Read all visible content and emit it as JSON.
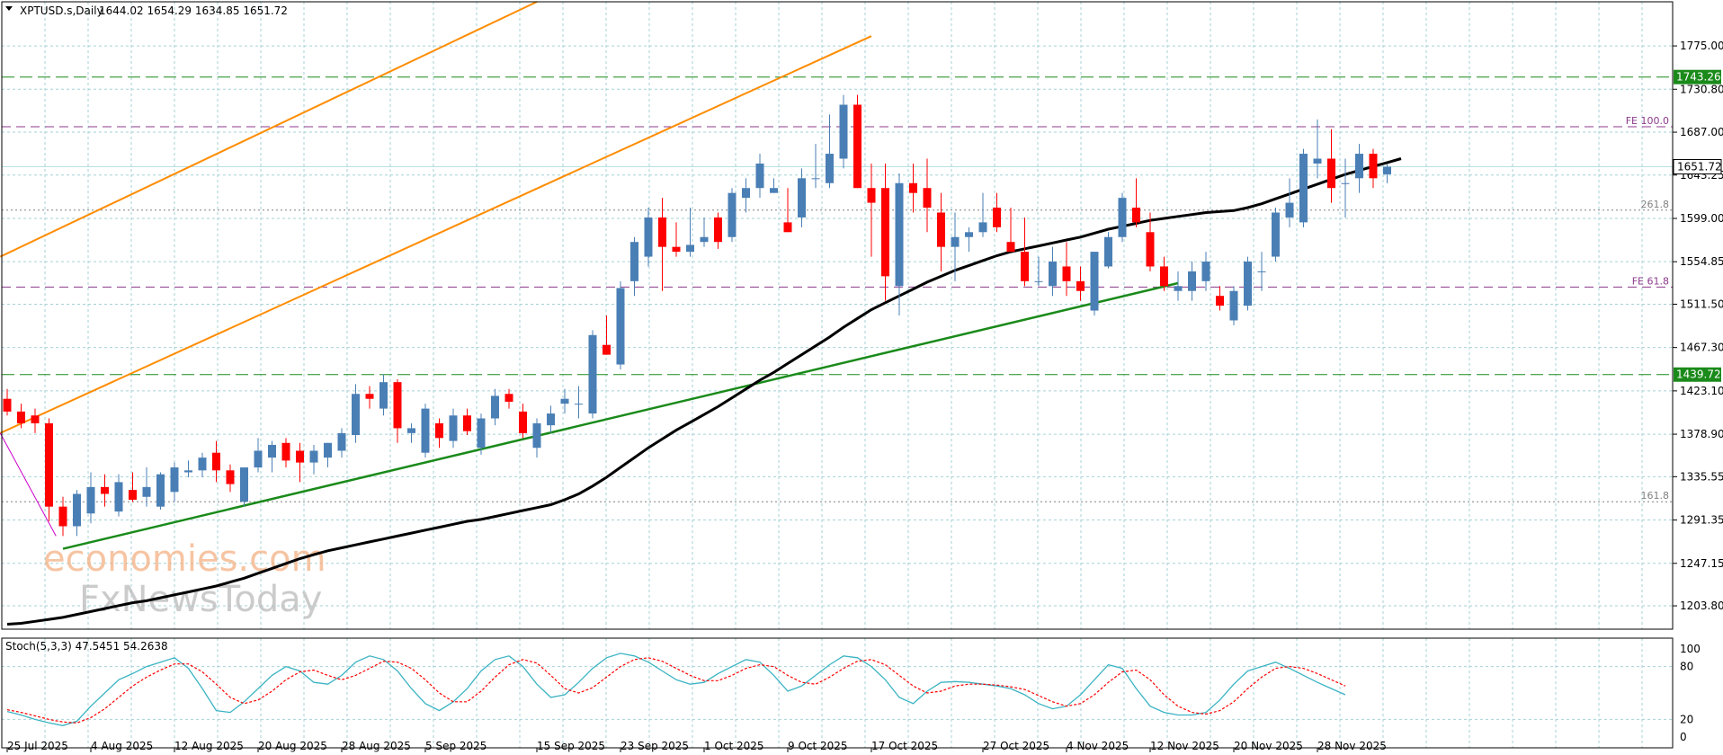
{
  "header": {
    "symbol": "XPTUSD.s,Daily",
    "ohlc": "1644.02 1654.29 1634.85 1651.72"
  },
  "watermark": {
    "line1": "economies.com",
    "line2": "FxNewsToday"
  },
  "oscillator": {
    "label": "Stoch(5,3,3) 47.5451 54.2638",
    "scale": [
      "100",
      "80",
      "20",
      "0"
    ]
  },
  "colors": {
    "bull": "#4a7fb5",
    "bear": "#ff0000",
    "grid": "#a6d2d6",
    "ma": "#000000",
    "channel": "#ff8c00",
    "trendline": "#1a8a1a",
    "support_resistance": "#1a8a1a",
    "fib": "#8b3a8b",
    "stoch_main": "#3bb3c3",
    "stoch_signal": "#ff0000"
  },
  "chart_data": {
    "type": "candlestick",
    "symbol": "XPTUSD.s",
    "timeframe": "Daily",
    "y_ticks": [
      "1775.00",
      "1730.80",
      "1687.00",
      "1643.25",
      "1599.00",
      "1554.85",
      "1511.50",
      "1467.30",
      "1423.10",
      "1378.90",
      "1335.55",
      "1291.35",
      "1247.15",
      "1203.80"
    ],
    "y_range": [
      1180,
      1820
    ],
    "x_ticks": [
      "25 Jul 2025",
      "4 Aug 2025",
      "12 Aug 2025",
      "20 Aug 2025",
      "28 Aug 2025",
      "5 Sep 2025",
      "15 Sep 2025",
      "23 Sep 2025",
      "1 Oct 2025",
      "9 Oct 2025",
      "17 Oct 2025",
      "27 Oct 2025",
      "4 Nov 2025",
      "12 Nov 2025",
      "20 Nov 2025",
      "28 Nov 2025"
    ],
    "x_tick_index": [
      0,
      6,
      12,
      18,
      24,
      30,
      38,
      44,
      50,
      56,
      62,
      70,
      76,
      82,
      88,
      94
    ],
    "current_price": "1651.72",
    "levels": [
      {
        "name": "resistance",
        "value": 1743.26,
        "label": "1743.26",
        "style": "dashed-green"
      },
      {
        "name": "support",
        "value": 1439.72,
        "label": "1439.72",
        "style": "dashed-green"
      },
      {
        "name": "fe-100",
        "value": 1692.5,
        "label": "FE 100.0",
        "style": "dashed-purple"
      },
      {
        "name": "fe-61.8",
        "value": 1529.0,
        "label": "FE 61.8",
        "style": "dashed-purple"
      },
      {
        "name": "fib-261.8",
        "value": 1607.5,
        "label": "261.8",
        "style": "dotted-gray"
      },
      {
        "name": "fib-161.8",
        "value": 1310.0,
        "label": "161.8",
        "style": "dotted-gray"
      }
    ],
    "candles": [
      {
        "o": 1415,
        "h": 1425,
        "l": 1398,
        "c": 1402
      },
      {
        "o": 1402,
        "h": 1410,
        "l": 1385,
        "c": 1390
      },
      {
        "o": 1398,
        "h": 1405,
        "l": 1380,
        "c": 1390
      },
      {
        "o": 1390,
        "h": 1395,
        "l": 1290,
        "c": 1305
      },
      {
        "o": 1305,
        "h": 1315,
        "l": 1275,
        "c": 1285
      },
      {
        "o": 1285,
        "h": 1322,
        "l": 1275,
        "c": 1318
      },
      {
        "o": 1298,
        "h": 1340,
        "l": 1288,
        "c": 1325
      },
      {
        "o": 1325,
        "h": 1338,
        "l": 1305,
        "c": 1318
      },
      {
        "o": 1300,
        "h": 1338,
        "l": 1295,
        "c": 1330
      },
      {
        "o": 1322,
        "h": 1340,
        "l": 1310,
        "c": 1312
      },
      {
        "o": 1315,
        "h": 1345,
        "l": 1305,
        "c": 1325
      },
      {
        "o": 1305,
        "h": 1340,
        "l": 1302,
        "c": 1338
      },
      {
        "o": 1320,
        "h": 1350,
        "l": 1310,
        "c": 1345
      },
      {
        "o": 1340,
        "h": 1352,
        "l": 1335,
        "c": 1342
      },
      {
        "o": 1342,
        "h": 1360,
        "l": 1335,
        "c": 1355
      },
      {
        "o": 1360,
        "h": 1372,
        "l": 1330,
        "c": 1342
      },
      {
        "o": 1342,
        "h": 1348,
        "l": 1320,
        "c": 1328
      },
      {
        "o": 1310,
        "h": 1345,
        "l": 1305,
        "c": 1345
      },
      {
        "o": 1345,
        "h": 1375,
        "l": 1340,
        "c": 1362
      },
      {
        "o": 1355,
        "h": 1372,
        "l": 1340,
        "c": 1368
      },
      {
        "o": 1370,
        "h": 1375,
        "l": 1345,
        "c": 1352
      },
      {
        "o": 1362,
        "h": 1370,
        "l": 1330,
        "c": 1350
      },
      {
        "o": 1350,
        "h": 1368,
        "l": 1338,
        "c": 1362
      },
      {
        "o": 1355,
        "h": 1370,
        "l": 1345,
        "c": 1370
      },
      {
        "o": 1362,
        "h": 1385,
        "l": 1355,
        "c": 1380
      },
      {
        "o": 1378,
        "h": 1430,
        "l": 1370,
        "c": 1420
      },
      {
        "o": 1420,
        "h": 1428,
        "l": 1405,
        "c": 1415
      },
      {
        "o": 1405,
        "h": 1440,
        "l": 1398,
        "c": 1432
      },
      {
        "o": 1432,
        "h": 1435,
        "l": 1370,
        "c": 1385
      },
      {
        "o": 1380,
        "h": 1390,
        "l": 1370,
        "c": 1385
      },
      {
        "o": 1360,
        "h": 1410,
        "l": 1355,
        "c": 1405
      },
      {
        "o": 1390,
        "h": 1395,
        "l": 1365,
        "c": 1375
      },
      {
        "o": 1372,
        "h": 1405,
        "l": 1365,
        "c": 1398
      },
      {
        "o": 1398,
        "h": 1405,
        "l": 1378,
        "c": 1382
      },
      {
        "o": 1365,
        "h": 1400,
        "l": 1358,
        "c": 1395
      },
      {
        "o": 1395,
        "h": 1425,
        "l": 1388,
        "c": 1418
      },
      {
        "o": 1420,
        "h": 1425,
        "l": 1405,
        "c": 1412
      },
      {
        "o": 1402,
        "h": 1410,
        "l": 1375,
        "c": 1380
      },
      {
        "o": 1365,
        "h": 1395,
        "l": 1355,
        "c": 1390
      },
      {
        "o": 1388,
        "h": 1408,
        "l": 1380,
        "c": 1400
      },
      {
        "o": 1410,
        "h": 1425,
        "l": 1400,
        "c": 1415
      },
      {
        "o": 1410,
        "h": 1428,
        "l": 1395,
        "c": 1410
      },
      {
        "o": 1400,
        "h": 1485,
        "l": 1395,
        "c": 1480
      },
      {
        "o": 1470,
        "h": 1500,
        "l": 1460,
        "c": 1460
      },
      {
        "o": 1450,
        "h": 1535,
        "l": 1445,
        "c": 1528
      },
      {
        "o": 1535,
        "h": 1580,
        "l": 1520,
        "c": 1575
      },
      {
        "o": 1560,
        "h": 1610,
        "l": 1550,
        "c": 1600
      },
      {
        "o": 1600,
        "h": 1620,
        "l": 1525,
        "c": 1570
      },
      {
        "o": 1570,
        "h": 1595,
        "l": 1560,
        "c": 1565
      },
      {
        "o": 1565,
        "h": 1610,
        "l": 1560,
        "c": 1572
      },
      {
        "o": 1575,
        "h": 1600,
        "l": 1570,
        "c": 1580
      },
      {
        "o": 1600,
        "h": 1605,
        "l": 1568,
        "c": 1575
      },
      {
        "o": 1580,
        "h": 1630,
        "l": 1575,
        "c": 1625
      },
      {
        "o": 1620,
        "h": 1640,
        "l": 1605,
        "c": 1630
      },
      {
        "o": 1630,
        "h": 1665,
        "l": 1620,
        "c": 1655
      },
      {
        "o": 1625,
        "h": 1640,
        "l": 1625,
        "c": 1630
      },
      {
        "o": 1595,
        "h": 1630,
        "l": 1590,
        "c": 1585
      },
      {
        "o": 1600,
        "h": 1650,
        "l": 1590,
        "c": 1640
      },
      {
        "o": 1640,
        "h": 1675,
        "l": 1630,
        "c": 1640
      },
      {
        "o": 1635,
        "h": 1705,
        "l": 1630,
        "c": 1665
      },
      {
        "o": 1660,
        "h": 1725,
        "l": 1650,
        "c": 1715
      },
      {
        "o": 1715,
        "h": 1725,
        "l": 1630,
        "c": 1630
      },
      {
        "o": 1630,
        "h": 1655,
        "l": 1560,
        "c": 1615
      },
      {
        "o": 1630,
        "h": 1655,
        "l": 1515,
        "c": 1540
      },
      {
        "o": 1530,
        "h": 1645,
        "l": 1500,
        "c": 1635
      },
      {
        "o": 1635,
        "h": 1655,
        "l": 1605,
        "c": 1625
      },
      {
        "o": 1630,
        "h": 1660,
        "l": 1585,
        "c": 1610
      },
      {
        "o": 1605,
        "h": 1625,
        "l": 1545,
        "c": 1570
      },
      {
        "o": 1570,
        "h": 1605,
        "l": 1535,
        "c": 1580
      },
      {
        "o": 1580,
        "h": 1590,
        "l": 1565,
        "c": 1585
      },
      {
        "o": 1585,
        "h": 1625,
        "l": 1580,
        "c": 1595
      },
      {
        "o": 1610,
        "h": 1625,
        "l": 1585,
        "c": 1590
      },
      {
        "o": 1575,
        "h": 1610,
        "l": 1565,
        "c": 1565
      },
      {
        "o": 1565,
        "h": 1600,
        "l": 1530,
        "c": 1535
      },
      {
        "o": 1535,
        "h": 1560,
        "l": 1530,
        "c": 1535
      },
      {
        "o": 1530,
        "h": 1570,
        "l": 1520,
        "c": 1555
      },
      {
        "o": 1550,
        "h": 1575,
        "l": 1520,
        "c": 1535
      },
      {
        "o": 1535,
        "h": 1550,
        "l": 1515,
        "c": 1525
      },
      {
        "o": 1505,
        "h": 1565,
        "l": 1500,
        "c": 1565
      },
      {
        "o": 1550,
        "h": 1585,
        "l": 1548,
        "c": 1580
      },
      {
        "o": 1580,
        "h": 1625,
        "l": 1575,
        "c": 1620
      },
      {
        "o": 1610,
        "h": 1640,
        "l": 1590,
        "c": 1595
      },
      {
        "o": 1585,
        "h": 1605,
        "l": 1545,
        "c": 1550
      },
      {
        "o": 1550,
        "h": 1560,
        "l": 1525,
        "c": 1530
      },
      {
        "o": 1525,
        "h": 1545,
        "l": 1515,
        "c": 1530
      },
      {
        "o": 1525,
        "h": 1555,
        "l": 1515,
        "c": 1545
      },
      {
        "o": 1535,
        "h": 1565,
        "l": 1525,
        "c": 1555
      },
      {
        "o": 1520,
        "h": 1530,
        "l": 1505,
        "c": 1510
      },
      {
        "o": 1495,
        "h": 1530,
        "l": 1490,
        "c": 1525
      },
      {
        "o": 1510,
        "h": 1560,
        "l": 1505,
        "c": 1555
      },
      {
        "o": 1545,
        "h": 1565,
        "l": 1525,
        "c": 1545
      },
      {
        "o": 1560,
        "h": 1610,
        "l": 1555,
        "c": 1605
      },
      {
        "o": 1600,
        "h": 1640,
        "l": 1590,
        "c": 1615
      },
      {
        "o": 1595,
        "h": 1670,
        "l": 1590,
        "c": 1665
      },
      {
        "o": 1655,
        "h": 1700,
        "l": 1640,
        "c": 1660
      },
      {
        "o": 1660,
        "h": 1690,
        "l": 1615,
        "c": 1630
      },
      {
        "o": 1635,
        "h": 1660,
        "l": 1600,
        "c": 1635
      },
      {
        "o": 1640,
        "h": 1675,
        "l": 1625,
        "c": 1665
      },
      {
        "o": 1665,
        "h": 1670,
        "l": 1630,
        "c": 1640
      },
      {
        "o": 1644.02,
        "h": 1654.29,
        "l": 1634.85,
        "c": 1651.72
      }
    ],
    "ma": [
      1185,
      1186,
      1188,
      1190,
      1192,
      1195,
      1198,
      1201,
      1204,
      1207,
      1209,
      1212,
      1215,
      1218,
      1221,
      1224,
      1228,
      1232,
      1237,
      1242,
      1247,
      1252,
      1256,
      1260,
      1263,
      1266,
      1269,
      1272,
      1275,
      1278,
      1281,
      1284,
      1287,
      1290,
      1292,
      1295,
      1298,
      1301,
      1304,
      1307,
      1312,
      1318,
      1326,
      1335,
      1345,
      1355,
      1365,
      1374,
      1383,
      1391,
      1399,
      1407,
      1416,
      1425,
      1434,
      1442,
      1451,
      1460,
      1469,
      1478,
      1488,
      1497,
      1506,
      1513,
      1520,
      1527,
      1534,
      1540,
      1546,
      1551,
      1556,
      1561,
      1565,
      1568,
      1571,
      1574,
      1577,
      1580,
      1584,
      1588,
      1591,
      1594,
      1597,
      1599,
      1601,
      1603,
      1605,
      1606,
      1607,
      1610,
      1614,
      1619,
      1624,
      1629,
      1634,
      1639,
      1644,
      1648,
      1652,
      1656,
      1660
    ],
    "stoch": {
      "ymin": 0,
      "ymax": 100,
      "main": [
        29,
        25,
        20,
        16,
        13,
        18,
        35,
        50,
        65,
        72,
        80,
        85,
        90,
        78,
        55,
        30,
        28,
        40,
        55,
        70,
        80,
        75,
        62,
        60,
        70,
        85,
        92,
        88,
        75,
        55,
        38,
        30,
        40,
        55,
        75,
        88,
        92,
        80,
        60,
        45,
        48,
        62,
        78,
        90,
        95,
        92,
        85,
        75,
        65,
        60,
        62,
        72,
        80,
        88,
        85,
        70,
        52,
        58,
        70,
        82,
        92,
        90,
        80,
        65,
        45,
        38,
        52,
        62,
        63,
        62,
        60,
        58,
        55,
        48,
        38,
        32,
        35,
        48,
        65,
        82,
        78,
        55,
        35,
        28,
        25,
        25,
        28,
        42,
        60,
        75,
        80,
        85,
        78,
        70,
        62,
        55,
        48
      ],
      "signal": [
        31,
        28,
        24,
        20,
        17,
        16,
        22,
        32,
        45,
        58,
        68,
        76,
        83,
        83,
        74,
        60,
        45,
        38,
        42,
        52,
        65,
        74,
        76,
        70,
        65,
        70,
        78,
        86,
        85,
        78,
        65,
        50,
        40,
        40,
        52,
        68,
        82,
        88,
        84,
        70,
        55,
        50,
        56,
        68,
        80,
        88,
        90,
        86,
        78,
        70,
        64,
        64,
        70,
        78,
        82,
        80,
        70,
        62,
        60,
        68,
        78,
        86,
        88,
        82,
        70,
        58,
        50,
        52,
        58,
        60,
        60,
        59,
        57,
        54,
        47,
        40,
        35,
        38,
        48,
        62,
        74,
        76,
        65,
        48,
        35,
        28,
        26,
        30,
        40,
        55,
        68,
        78,
        80,
        78,
        72,
        65,
        58
      ]
    }
  }
}
